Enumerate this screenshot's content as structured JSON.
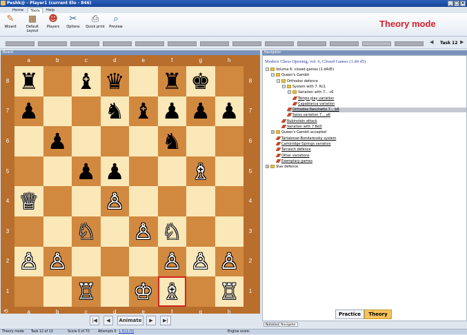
{
  "window": {
    "title": "Peshk@ - Player1 (current Elo - 846)",
    "buttons": [
      "_",
      "□",
      "×"
    ]
  },
  "ribbon": {
    "tabs": [
      "Home",
      "Tools",
      "Help"
    ],
    "active_tab": "Tools",
    "buttons": [
      {
        "label": "Wizard",
        "icon": "wizard-icon",
        "glyph": "✎"
      },
      {
        "label": "Default Layout",
        "icon": "layout-icon",
        "glyph": "▦"
      },
      {
        "label": "Players",
        "icon": "players-icon",
        "glyph": "☻"
      },
      {
        "label": "Options",
        "icon": "options-icon",
        "glyph": "✂"
      },
      {
        "label": "Quick print",
        "icon": "print-icon",
        "glyph": "⎙"
      },
      {
        "label": "Preview",
        "icon": "preview-icon",
        "glyph": "⌕"
      }
    ],
    "mode_label": "Theory mode"
  },
  "taskbar": {
    "task_label": "Task",
    "task_number": "12",
    "prev": "◀",
    "next": "▶"
  },
  "board_panel": {
    "title": "Board"
  },
  "board": {
    "files": [
      "a",
      "b",
      "c",
      "d",
      "e",
      "f",
      "g",
      "h"
    ],
    "ranks": [
      "8",
      "7",
      "6",
      "5",
      "4",
      "3",
      "2",
      "1"
    ],
    "highlight": "f1",
    "pieces": {
      "a8": "♜b",
      "c8": "♝b",
      "d8": "♛b",
      "f8": "♜b",
      "g8": "♚b",
      "a7": "♟b",
      "d7": "♞b",
      "e7": "♝b",
      "f7": "♟b",
      "g7": "♟b",
      "h7": "♟b",
      "b6": "♟b",
      "f6": "♞b",
      "c5": "♟b",
      "d5": "♟b",
      "g5": "♗w",
      "a4": "♕w",
      "d4": "♙w",
      "c3": "♘w",
      "e3": "♙w",
      "f3": "♘w",
      "a2": "♙w",
      "b2": "♙w",
      "f2": "♙w",
      "g2": "♙w",
      "h2": "♙w",
      "c1": "♖w",
      "e1": "♔w",
      "f1": "♗w",
      "h1": "♖w"
    },
    "controls": {
      "first": "|◀",
      "prev": "◀",
      "animate": "Animate",
      "next": "▶",
      "last": "▶|"
    }
  },
  "navigator": {
    "panel_title": "Navigator",
    "heading": "Modern Chess Opening, vol. 6, Closed Games (1.d4 d5)",
    "tree": [
      {
        "label": "Volume 6: closed games (1.d4d5)",
        "depth": 0,
        "kind": "folder",
        "exp": "−"
      },
      {
        "label": "Queen's Gambit",
        "depth": 1,
        "kind": "folder",
        "exp": "−"
      },
      {
        "label": "Orthodox defence",
        "depth": 2,
        "kind": "folder",
        "exp": "−"
      },
      {
        "label": "System with 7. Rc1",
        "depth": 3,
        "kind": "folder",
        "exp": "−"
      },
      {
        "label": "Variation with 7... c6",
        "depth": 4,
        "kind": "folder",
        "exp": "−"
      },
      {
        "label": "Tempo play variation",
        "depth": 5,
        "kind": "pen",
        "link": true
      },
      {
        "label": "Capablanca variation",
        "depth": 5,
        "kind": "pen",
        "link": true
      },
      {
        "label": "Orthodox fianchetto 7... b6",
        "depth": 4,
        "kind": "pen",
        "link": true,
        "selected": true
      },
      {
        "label": "Swiss variation 7... a6",
        "depth": 4,
        "kind": "pen",
        "link": true
      },
      {
        "label": "Rubinstein attack",
        "depth": 3,
        "kind": "pen",
        "link": true
      },
      {
        "label": "Variation with 7.Bd3",
        "depth": 3,
        "kind": "pen",
        "link": true
      },
      {
        "label": "Queen's Gambit accepted",
        "depth": 1,
        "kind": "folder",
        "exp": "+"
      },
      {
        "label": "Tartakover-Bondarevsky system",
        "depth": 2,
        "kind": "pen",
        "link": true
      },
      {
        "label": "Cambridge-Springs variation",
        "depth": 2,
        "kind": "pen",
        "link": true
      },
      {
        "label": "Tarrasch defence",
        "depth": 2,
        "kind": "pen",
        "link": true
      },
      {
        "label": "Other variations",
        "depth": 2,
        "kind": "pen",
        "link": true
      },
      {
        "label": "Exemplary games",
        "depth": 2,
        "kind": "pen",
        "link": true
      },
      {
        "label": "Slav defence",
        "depth": 0,
        "kind": "folder",
        "exp": "+"
      }
    ],
    "buttons": {
      "practice": "Practice",
      "theory": "Theory"
    },
    "bottom_tabs": [
      "Notation",
      "Navigator"
    ]
  },
  "status": {
    "mode": "Theory mode",
    "task": "Task 12 of 13",
    "score": "Score 0 of 70",
    "attempts": "Attempts 0",
    "move": "1.f1(1.f1)",
    "engine": "Engine score:"
  }
}
